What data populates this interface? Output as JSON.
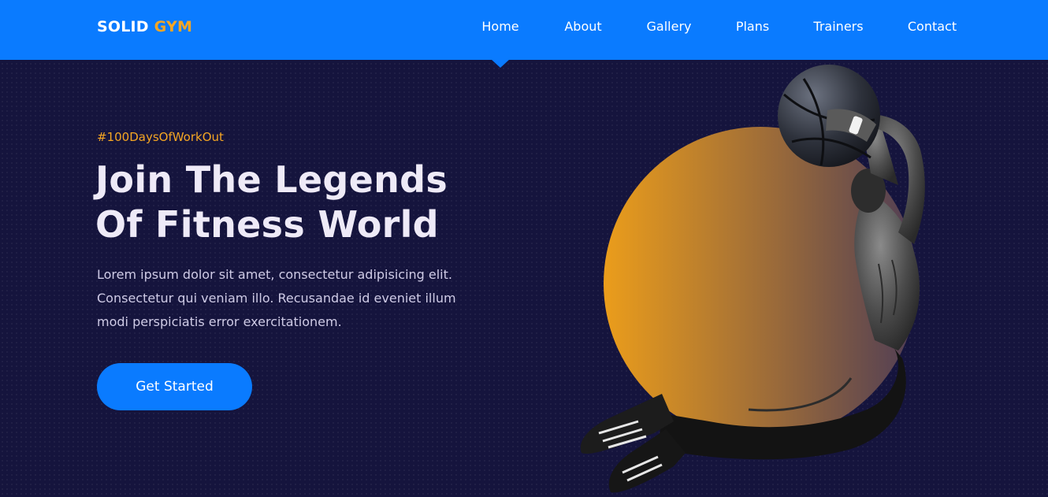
{
  "brand": {
    "name_part1": "SOLID",
    "name_part2": "GYM"
  },
  "nav": {
    "items": [
      "Home",
      "About",
      "Gallery",
      "Plans",
      "Trainers",
      "Contact"
    ],
    "active": "Home"
  },
  "hero": {
    "hashtag": "#100DaysOfWorkOut",
    "title_line1": "Join The Legends",
    "title_line2": "Of Fitness World",
    "description_line1": "Lorem ipsum dolor sit amet, consectetur adipisicing elit.",
    "description_line2": "Consectetur qui veniam illo. Recusandae id eveniet illum",
    "description_line3": "modi perspiciatis error exercitationem.",
    "cta_label": "Get Started"
  },
  "colors": {
    "primary": "#0a7bff",
    "accent": "#f5a623",
    "background": "#15143d",
    "heading": "#eeeaf7"
  },
  "image": {
    "alt": "athlete-throwing-medicine-ball"
  }
}
